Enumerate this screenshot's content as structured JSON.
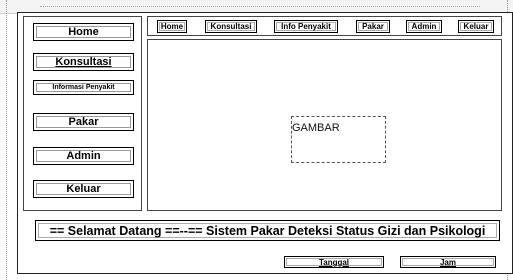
{
  "sidebar": {
    "items": [
      {
        "label": "Home"
      },
      {
        "label": "Konsultasi"
      },
      {
        "label": "Informasi Penyakit"
      },
      {
        "label": "Pakar"
      },
      {
        "label": "Admin"
      },
      {
        "label": "Keluar"
      }
    ]
  },
  "topnav": {
    "items": [
      {
        "label": "Home"
      },
      {
        "label": "Konsultasi"
      },
      {
        "label": "Info Penyakit"
      },
      {
        "label": "Pakar"
      },
      {
        "label": "Admin"
      },
      {
        "label": "Keluar"
      }
    ]
  },
  "main": {
    "image_placeholder": "GAMBAR"
  },
  "welcome_banner": "== Selamat Datang ==--== Sistem Pakar Deteksi Status Gizi dan Psikologi",
  "footer": {
    "date_label": "Tanggal",
    "time_label": "Jam"
  }
}
